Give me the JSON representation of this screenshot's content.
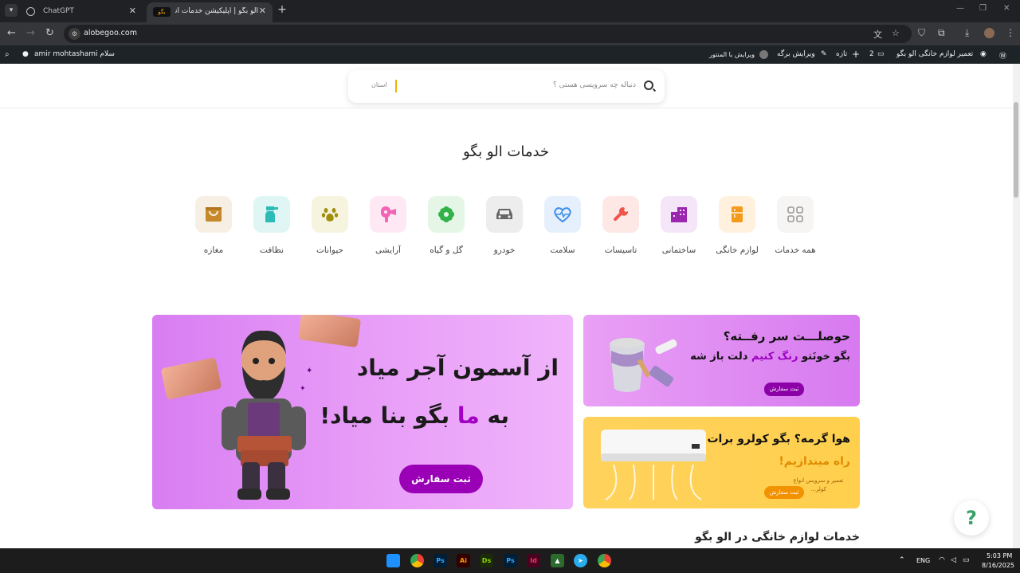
{
  "browser": {
    "tabs": [
      {
        "title": "ChatGPT"
      },
      {
        "title": "الو بگو | اپلیکیشن خدمات آنلاین و",
        "favicon_text": "بگو"
      }
    ],
    "url": "alobegoo.com"
  },
  "wp_admin_bar": {
    "site_name": "تعمیر لوازم خانگی الو بگو",
    "comments_count": "2",
    "new_label": "تازه",
    "edit_page": "ویرایش برگه",
    "edit_elementor": "ویرایش با المنتور",
    "greeting": "سلام amir mohtashami"
  },
  "search": {
    "placeholder": "دنباله چه سرویسی هستی ؟",
    "province": "استان"
  },
  "services_title": "خدمات الو بگو",
  "categories": [
    {
      "label": "همه خدمات",
      "icon": "grid-icon",
      "bg": "#f7f5f3",
      "color": "#9a9a9a"
    },
    {
      "label": "لوازم خانگی",
      "icon": "fridge-icon",
      "bg": "#fff1de",
      "color": "#f39a1a"
    },
    {
      "label": "ساختمانی",
      "icon": "building-icon",
      "bg": "#f4e5f9",
      "color": "#9b27b0"
    },
    {
      "label": "تاسیسات",
      "icon": "wrench-icon",
      "bg": "#fde8e6",
      "color": "#f0544a"
    },
    {
      "label": "سلامت",
      "icon": "heart-pulse-icon",
      "bg": "#e6f0fc",
      "color": "#3d8ee8"
    },
    {
      "label": "خودرو",
      "icon": "car-icon",
      "bg": "#ededed",
      "color": "#666666"
    },
    {
      "label": "گل و گیاه",
      "icon": "flower-icon",
      "bg": "#e5f6e6",
      "color": "#33b24a"
    },
    {
      "label": "آرایشی",
      "icon": "hairdryer-icon",
      "bg": "#fde8f4",
      "color": "#f264b6"
    },
    {
      "label": "حیوانات",
      "icon": "paw-icon",
      "bg": "#f6f3df",
      "color": "#a08e0c"
    },
    {
      "label": "نظافت",
      "icon": "spray-icon",
      "bg": "#dff6f5",
      "color": "#2bbcb6"
    },
    {
      "label": "مغازه",
      "icon": "shop-icon",
      "bg": "#f7efe3",
      "color": "#c68a2c"
    }
  ],
  "banners": {
    "main": {
      "line1": "از آسمون آجر میاد",
      "line2_prefix": "به",
      "line2_accent": "ما",
      "line2_suffix": "بگو بنا میاد!",
      "button": "ثبت سفارش"
    },
    "paint": {
      "title": "حوصلـــت سر رفــته؟",
      "line_prefix": "بگو خونَتو",
      "line_accent": "رنگ کنیم",
      "line_suffix": "دلت باز شه",
      "button": "ثبت سفارش"
    },
    "cooler": {
      "title": "هوا گرمه؟ بگو کولرو برات",
      "subtitle": "راه میندازیم!",
      "note": "تعمیر و سرویس انواع کولر...",
      "button": "ثبت سفارش"
    }
  },
  "section2_title": "خدمات لوازم خانگی در الو بگو",
  "help_button": "?",
  "taskbar": {
    "language": "ENG",
    "time": "5:03 PM",
    "date": "8/16/2025"
  }
}
